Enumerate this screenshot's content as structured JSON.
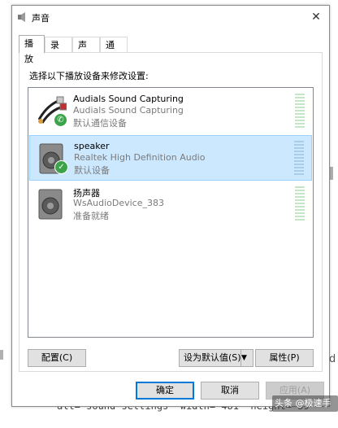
{
  "background": {
    "code_snippet": "alt=\"sound settings\" width=\"481\" height=\"59",
    "right_char": "d",
    "watermark": "头条 @极速手助"
  },
  "window": {
    "title": "声音",
    "close_icon": "close-icon",
    "tabs": [
      {
        "label": "播放",
        "active": true
      },
      {
        "label": "录制",
        "active": false
      },
      {
        "label": "声音",
        "active": false
      },
      {
        "label": "通信",
        "active": false
      }
    ],
    "instruction": "选择以下播放设备来修改设置:",
    "devices": [
      {
        "name": "Audials Sound Capturing",
        "description": "Audials Sound Capturing",
        "status": "默认通信设备",
        "icon": "rca-cable-icon",
        "badge": "phone-badge-icon",
        "selected": false
      },
      {
        "name": "speaker",
        "description": "Realtek High Definition Audio",
        "status": "默认设备",
        "icon": "speaker-icon",
        "badge": "checkmark-badge-icon",
        "selected": true
      },
      {
        "name": "扬声器",
        "description": "WsAudioDevice_383",
        "status": "准备就绪",
        "icon": "speaker-icon",
        "badge": "",
        "selected": false
      }
    ],
    "buttons": {
      "configure": "配置(C)",
      "set_default": "设为默认值(S)",
      "properties": "属性(P)",
      "ok": "确定",
      "cancel": "取消",
      "apply": "应用(A)"
    },
    "colors": {
      "selection": "#cce8ff",
      "primary_border": "#0078d7",
      "status_green": "#3da34a"
    }
  }
}
